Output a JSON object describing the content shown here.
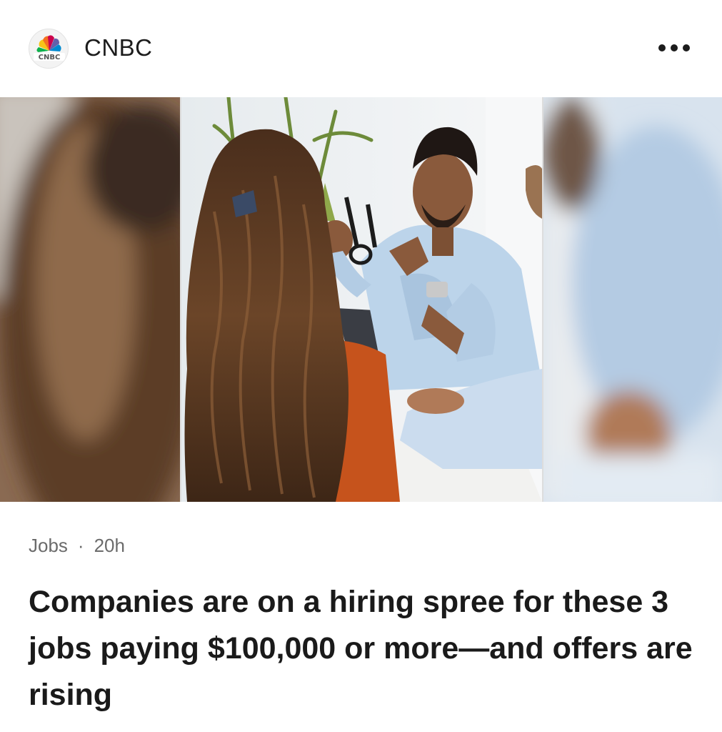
{
  "publisher": {
    "name": "CNBC",
    "logo_icon": "cnbc-peacock-icon",
    "logo_text": "CNBC"
  },
  "menu_icon": "more-horizontal-icon",
  "hero_image": {
    "description_icon": "article-photo",
    "colors": {
      "shirt": "#bcd4ea",
      "sweater": "#c6531c",
      "hair": "#5a3a22",
      "wall": "#eef0f2"
    }
  },
  "article": {
    "category": "Jobs",
    "separator": "·",
    "age": "20h",
    "headline": "Companies are on a hiring spree for these 3 jobs paying $100,000 or more—and offers are rising"
  }
}
